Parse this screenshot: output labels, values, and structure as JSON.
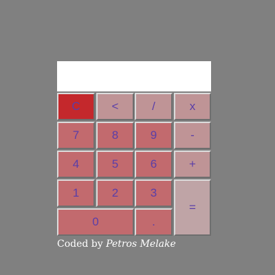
{
  "display": {
    "value": ""
  },
  "keys": {
    "clear": "C",
    "back": "<",
    "divide": "/",
    "multiply": "x",
    "seven": "7",
    "eight": "8",
    "nine": "9",
    "minus": "-",
    "four": "4",
    "five": "5",
    "six": "6",
    "plus": "+",
    "one": "1",
    "two": "2",
    "three": "3",
    "equals": "=",
    "zero": "0",
    "dot": "."
  },
  "credit": {
    "prefix": "Coded by ",
    "author": "Petros Melake"
  },
  "colors": {
    "background": "#808080",
    "number_key": "#c26a6e",
    "operator_key": "#bf9496",
    "clear_key": "#c4282c",
    "equals_key": "#bfa4a6",
    "key_text": "#5a3ea8"
  }
}
